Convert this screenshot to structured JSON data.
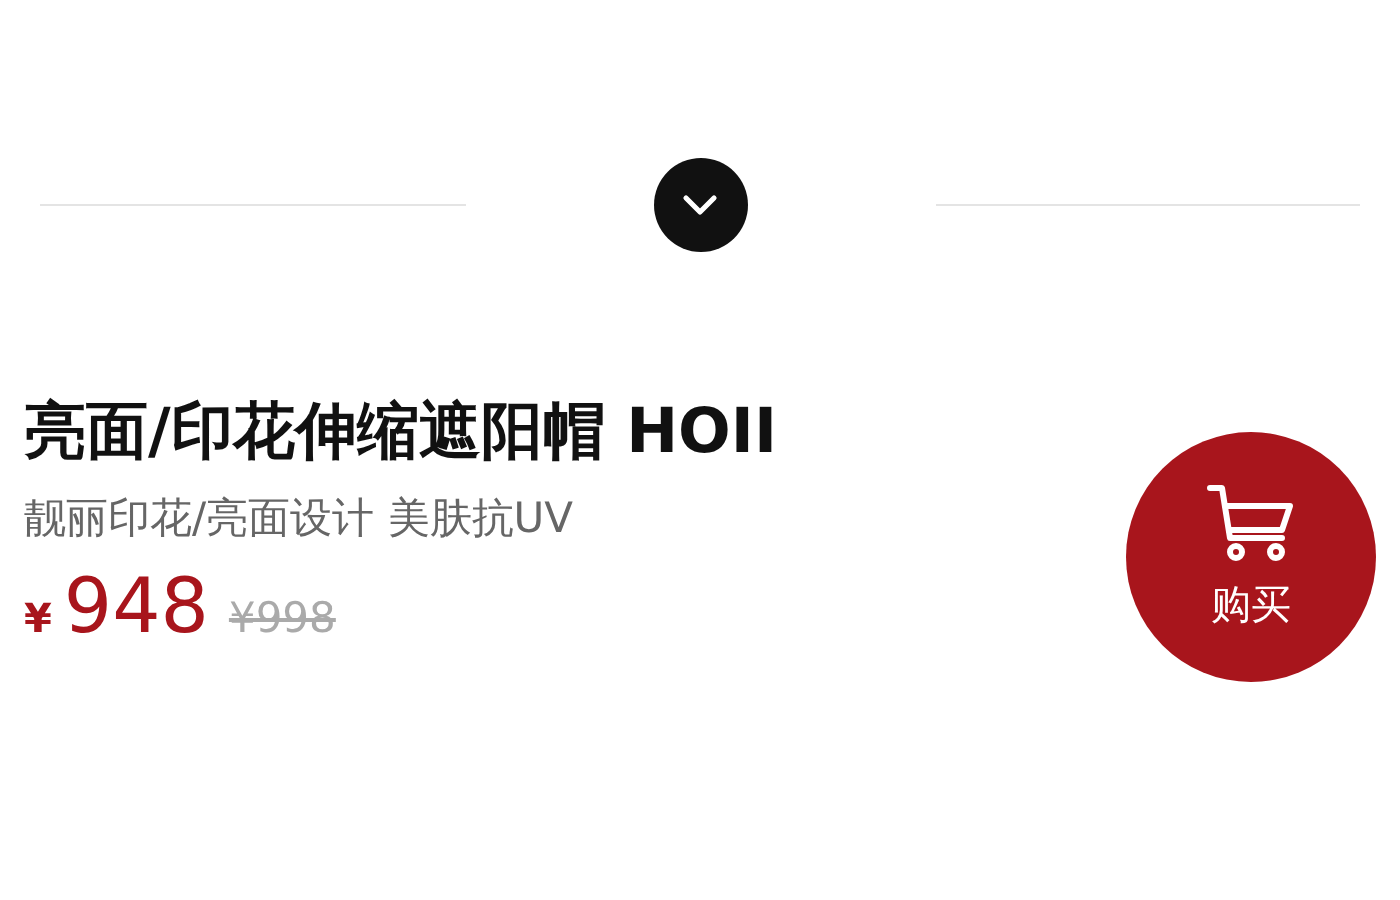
{
  "product": {
    "title": "亮面/印花伸缩遮阳帽 HOII",
    "subtitle": "靓丽印花/亮面设计 美肤抗UV",
    "currency": "¥",
    "price": "948",
    "original_price": "¥998"
  },
  "buy_button": {
    "label": "购买"
  }
}
